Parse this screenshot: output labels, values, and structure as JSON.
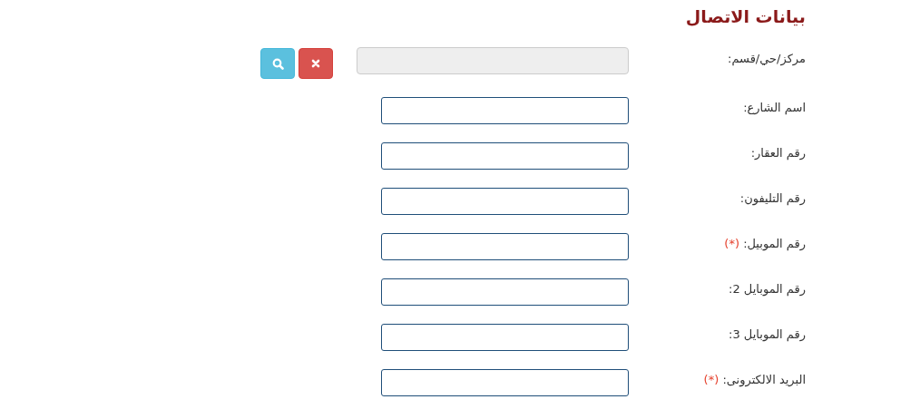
{
  "section": {
    "title": "بيانات الاتصال"
  },
  "fields": [
    {
      "kind": "lookup",
      "label": "مركز/حي/قسم:",
      "disabled": true
    },
    {
      "kind": "text",
      "label": "اسم الشارع:",
      "disabled": false
    },
    {
      "kind": "text",
      "label": "رقم العقار:",
      "disabled": false
    },
    {
      "kind": "text",
      "label": "رقم التليفون:",
      "disabled": false
    },
    {
      "kind": "text",
      "label": "رقم الموبيل:",
      "required_mark": "(*)",
      "disabled": false
    },
    {
      "kind": "text",
      "label": "رقم الموبايل 2:",
      "disabled": false
    },
    {
      "kind": "text",
      "label": "رقم الموبايل 3:",
      "disabled": false
    },
    {
      "kind": "text",
      "label": "البريد الالكترونى:",
      "required_mark": "(*)",
      "disabled": false
    }
  ]
}
